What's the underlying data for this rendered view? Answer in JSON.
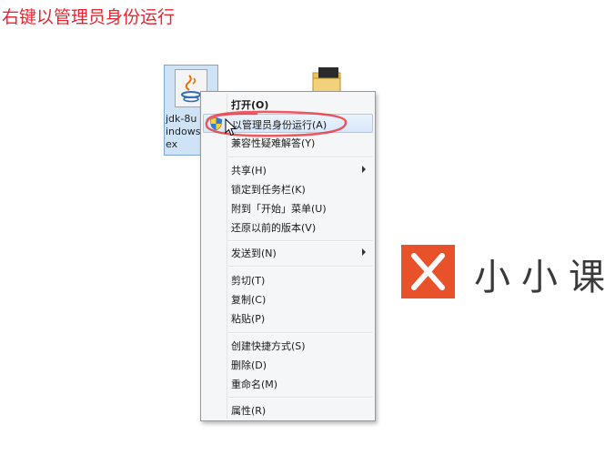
{
  "annotation": {
    "title": "右键以管理员身份运行"
  },
  "desktop": {
    "file_label": "jdk-8u\nindows\nex"
  },
  "context_menu": {
    "items": [
      {
        "label": "打开(O)",
        "bold": true
      },
      {
        "label": "以管理员身份运行(A)",
        "icon": "uac-shield-icon",
        "highlighted": true
      },
      {
        "label": "兼容性疑难解答(Y)"
      },
      {
        "label": "共享(H)",
        "submenu": true
      },
      {
        "label": "锁定到任务栏(K)"
      },
      {
        "label": "附到「开始」菜单(U)"
      },
      {
        "label": "还原以前的版本(V)"
      },
      {
        "label": "发送到(N)",
        "submenu": true
      },
      {
        "label": "剪切(T)"
      },
      {
        "label": "复制(C)"
      },
      {
        "label": "粘贴(P)"
      },
      {
        "label": "创建快捷方式(S)"
      },
      {
        "label": "删除(D)"
      },
      {
        "label": "重命名(M)"
      },
      {
        "label": "属性(R)"
      }
    ]
  },
  "brand": {
    "logo_glyph": "X",
    "text": "小小课"
  },
  "colors": {
    "annotation_red": "#e8242f",
    "brand_orange": "#e8522a",
    "menu_hover": "#d8e8fb"
  }
}
